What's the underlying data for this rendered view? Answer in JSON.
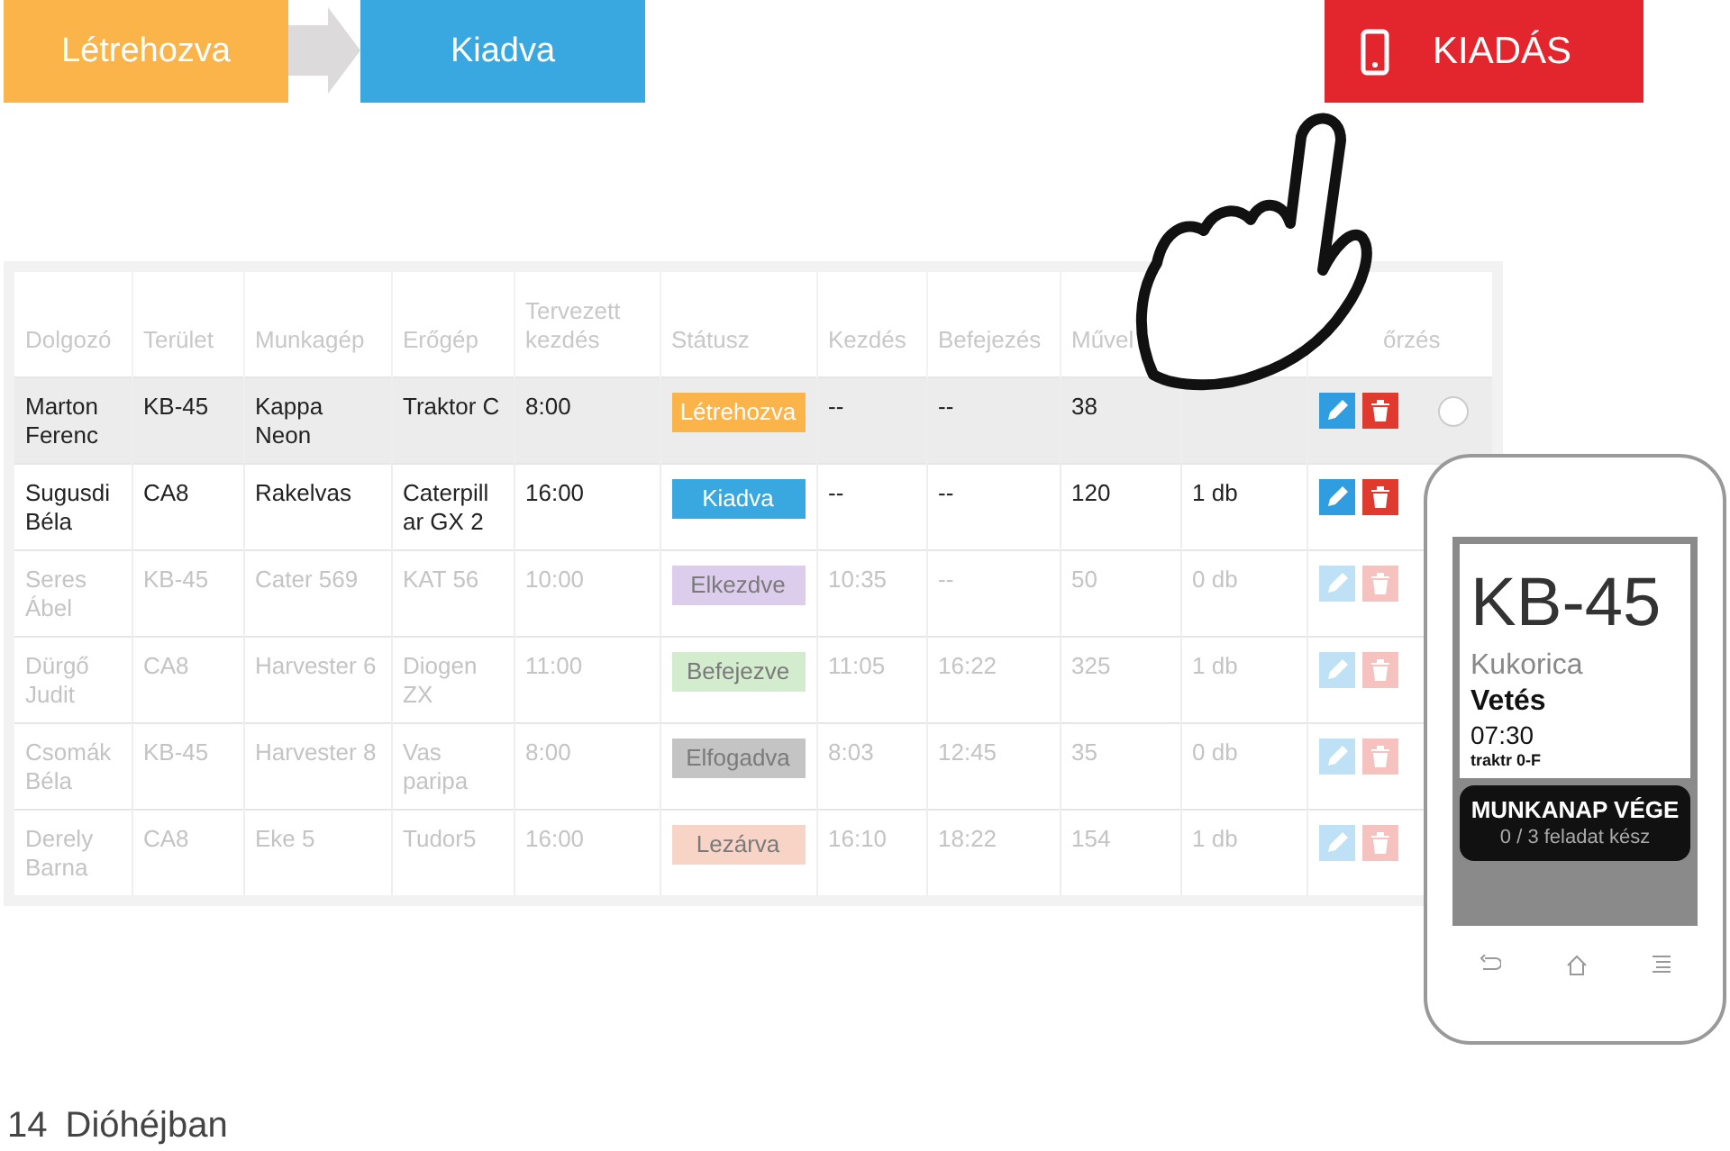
{
  "flow": [
    {
      "label": "Létrehozva",
      "color": "#fbb44a"
    },
    {
      "label": "Kiadva",
      "color": "#3aa8e0"
    }
  ],
  "action_button": {
    "label": "KIADÁS"
  },
  "table": {
    "columns": [
      {
        "label": "Dolgozó"
      },
      {
        "label": "Terület"
      },
      {
        "label": "Munkagép"
      },
      {
        "label": "Erőgép"
      },
      {
        "label": "Tervezett kezdés"
      },
      {
        "label": "Státusz"
      },
      {
        "label": "Kezdés"
      },
      {
        "label": "Befejezés"
      },
      {
        "label": "Művel"
      },
      {},
      {
        "label": "őrzés"
      }
    ],
    "rows": [
      {
        "active": true,
        "highlighted": true,
        "cells": [
          "Marton Ferenc",
          "KB-45",
          "Kappa Neon",
          "Traktor C",
          "8:00",
          "Létrehozva",
          "--",
          "--",
          "38"
        ],
        "color": "#fbb44a",
        "radio": {
          "selected": false
        }
      },
      {
        "active": true,
        "highlighted": false,
        "cells": [
          "Sugusdi Béla",
          "CA8",
          "Rakelvas",
          "Caterpill ar GX 2",
          "16:00",
          "Kiadva",
          "--",
          "--",
          "120",
          "1 db"
        ],
        "color": "#3aa8e0"
      },
      {
        "active": false,
        "highlighted": false,
        "cells": [
          "Seres Ábel",
          "KB-45",
          "Cater 569",
          "KAT 56",
          "10:00",
          "Elkezdve",
          "10:35",
          "--",
          "50",
          "0 db"
        ],
        "color": "#dccdec"
      },
      {
        "active": false,
        "highlighted": false,
        "cells": [
          "Dürgő Judit",
          "CA8",
          "Harvester 6",
          "Diogen ZX",
          "11:00",
          "Befejezve",
          "11:05",
          "16:22",
          "325",
          "1 db"
        ],
        "color": "#d3ecce"
      },
      {
        "active": false,
        "highlighted": false,
        "cells": [
          "Csomák Béla",
          "KB-45",
          "Harvester 8",
          "Vas paripa",
          "8:00",
          "Elfogadva",
          "8:03",
          "12:45",
          "35",
          "0 db"
        ],
        "color": "#c4c4c4"
      },
      {
        "active": false,
        "highlighted": false,
        "cells": [
          "Derely Barna",
          "CA8",
          "Eke 5",
          "Tudor5",
          "16:00",
          "Lezárva",
          "16:10",
          "18:22",
          "154",
          "1 db"
        ],
        "color": "#f8d4c6"
      }
    ]
  },
  "phone": {
    "title": "KB-45",
    "crop": "Kukorica",
    "task": "Vetés",
    "time": "07:30",
    "machine": "traktr 0-F",
    "button": "MUNKANAP VÉGE",
    "progress": "0 / 3 feladat kész"
  },
  "footer": {
    "page": "14",
    "title": "Dióhéjban"
  }
}
